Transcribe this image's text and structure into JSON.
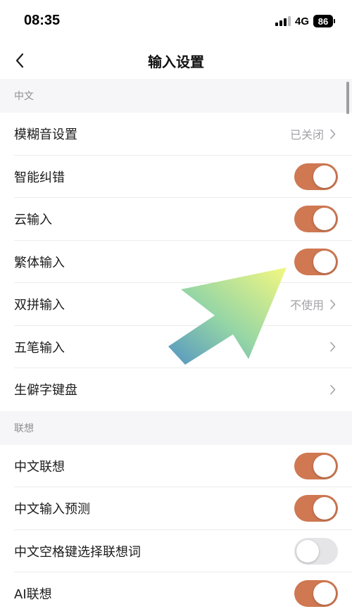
{
  "status_bar": {
    "time": "08:35",
    "network": "4G",
    "battery": "86"
  },
  "nav": {
    "title": "输入设置",
    "back_icon": "chevron-left-icon"
  },
  "colors": {
    "toggle_on": "#cf7852",
    "toggle_off": "#e5e5e8",
    "arrow_start": "#4b8fbf",
    "arrow_end": "#f3f77a"
  },
  "sections": [
    {
      "header": "中文",
      "rows": [
        {
          "label": "模糊音设置",
          "value": "已关闭",
          "type": "link"
        },
        {
          "label": "智能纠错",
          "type": "toggle",
          "on": true
        },
        {
          "label": "云输入",
          "type": "toggle",
          "on": true
        },
        {
          "label": "繁体输入",
          "type": "toggle",
          "on": true
        },
        {
          "label": "双拼输入",
          "value": "不使用",
          "type": "link"
        },
        {
          "label": "五笔输入",
          "value": "",
          "type": "link"
        },
        {
          "label": "生僻字键盘",
          "value": "",
          "type": "link"
        }
      ]
    },
    {
      "header": "联想",
      "rows": [
        {
          "label": "中文联想",
          "type": "toggle",
          "on": true
        },
        {
          "label": "中文输入预测",
          "type": "toggle",
          "on": true
        },
        {
          "label": "中文空格键选择联想词",
          "type": "toggle",
          "on": false
        },
        {
          "label": "AI联想",
          "type": "toggle",
          "on": true
        }
      ]
    }
  ]
}
